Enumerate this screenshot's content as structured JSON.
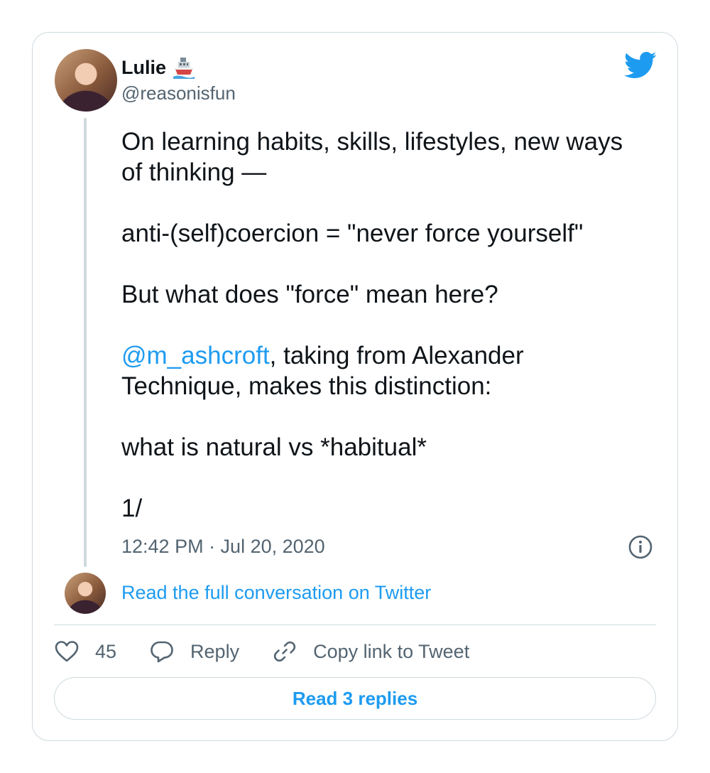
{
  "author": {
    "name": "Lulie",
    "handle": "@reasonisfun",
    "name_emoji": "ship-icon"
  },
  "tweet": {
    "paragraphs": [
      {
        "lines": [
          "On learning habits, skills, lifestyles, new ways",
          "of thinking —"
        ]
      },
      {
        "lines": [
          "anti-(self)coercion = \"never force yourself\""
        ]
      },
      {
        "lines": [
          "But what does \"force\" mean here?"
        ]
      },
      {
        "mention": "@m_ashcroft",
        "after_mention": ", taking from Alexander",
        "lines": [
          "Technique, makes this distinction:"
        ]
      },
      {
        "lines": [
          "what is natural vs *habitual*"
        ]
      },
      {
        "lines": [
          "1/"
        ]
      }
    ],
    "timestamp": "12:42 PM · Jul 20, 2020"
  },
  "conversation_link": "Read the full conversation on Twitter",
  "actions": {
    "like_count": "45",
    "reply_label": "Reply",
    "copy_link_label": "Copy link to Tweet"
  },
  "replies_button": "Read 3 replies",
  "colors": {
    "accent": "#1d9bf0",
    "text": "#0f1419",
    "secondary": "#536471",
    "border": "#cfd9de"
  },
  "icons": [
    "twitter-logo-icon",
    "info-icon",
    "heart-icon",
    "reply-bubble-icon",
    "link-icon",
    "ship-icon"
  ]
}
